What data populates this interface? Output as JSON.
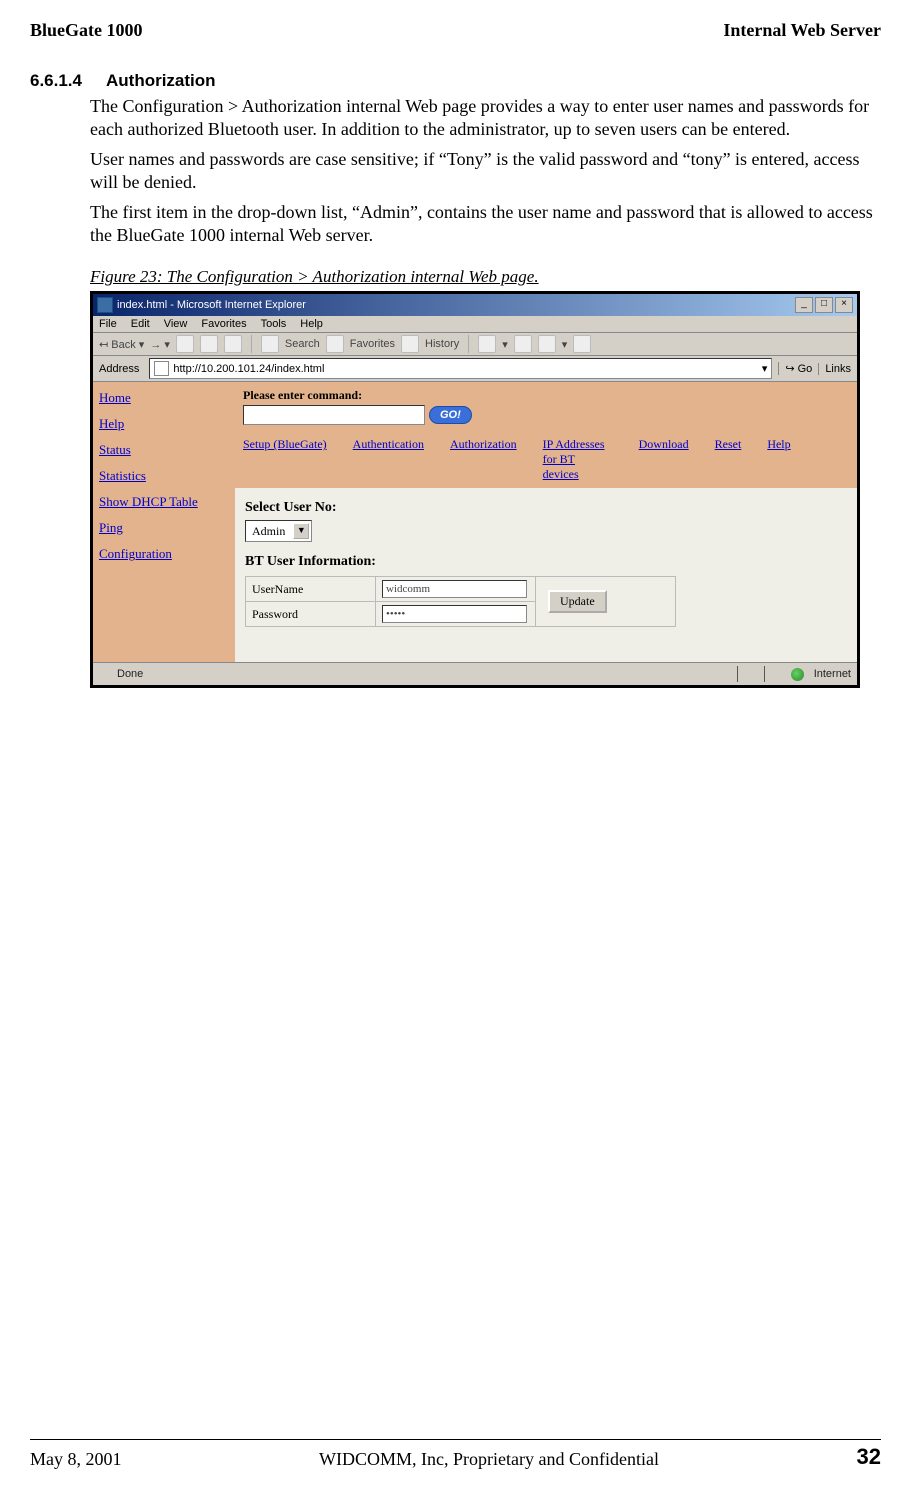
{
  "header": {
    "left": "BlueGate 1000",
    "right": "Internal Web Server"
  },
  "section": {
    "number": "6.6.1.4",
    "title": "Authorization"
  },
  "paragraphs": {
    "p1": "The Configuration > Authorization internal Web page provides a way to enter user names and passwords for each authorized Bluetooth user. In addition to the administrator, up to seven users can be entered.",
    "p2": "User names and passwords are case sensitive; if “Tony” is the valid password and “tony” is entered, access will be denied.",
    "p3": "The first item in the drop-down list, “Admin”, contains the user name and password that is allowed to access the BlueGate 1000 internal Web server."
  },
  "figure_caption": "Figure 23: The Configuration > Authorization internal Web page.",
  "ie": {
    "title": "index.html - Microsoft Internet Explorer",
    "menus": {
      "file": "File",
      "edit": "Edit",
      "view": "View",
      "favorites": "Favorites",
      "tools": "Tools",
      "help": "Help"
    },
    "toolbar": {
      "back": "Back",
      "search": "Search",
      "favorites": "Favorites",
      "history": "History"
    },
    "address_label": "Address",
    "address_value": "http://10.200.101.24/index.html",
    "go": "Go",
    "links": "Links",
    "status_left": "Done",
    "status_right": "Internet"
  },
  "sidebar": {
    "home": "Home",
    "help": "Help",
    "status": "Status",
    "statistics": "Statistics",
    "dhcp": "Show DHCP Table",
    "ping": "Ping",
    "config": "Configuration"
  },
  "command": {
    "label": "Please enter command:",
    "go": "GO!"
  },
  "toplinks": {
    "setup": "Setup (BlueGate)",
    "authn": "Authentication",
    "authz": "Authorization",
    "ip": "IP Addresses for BT devices",
    "download": "Download",
    "reset": "Reset",
    "help": "Help"
  },
  "form": {
    "select_label": "Select User No:",
    "select_value": "Admin",
    "info_label": "BT User Information:",
    "username_label": "UserName",
    "username_value": "widcomm",
    "password_label": "Password",
    "password_value": "•••••",
    "update": "Update"
  },
  "footer": {
    "date": "May 8, 2001",
    "center": "WIDCOMM, Inc, Proprietary and Confidential",
    "page": "32"
  }
}
